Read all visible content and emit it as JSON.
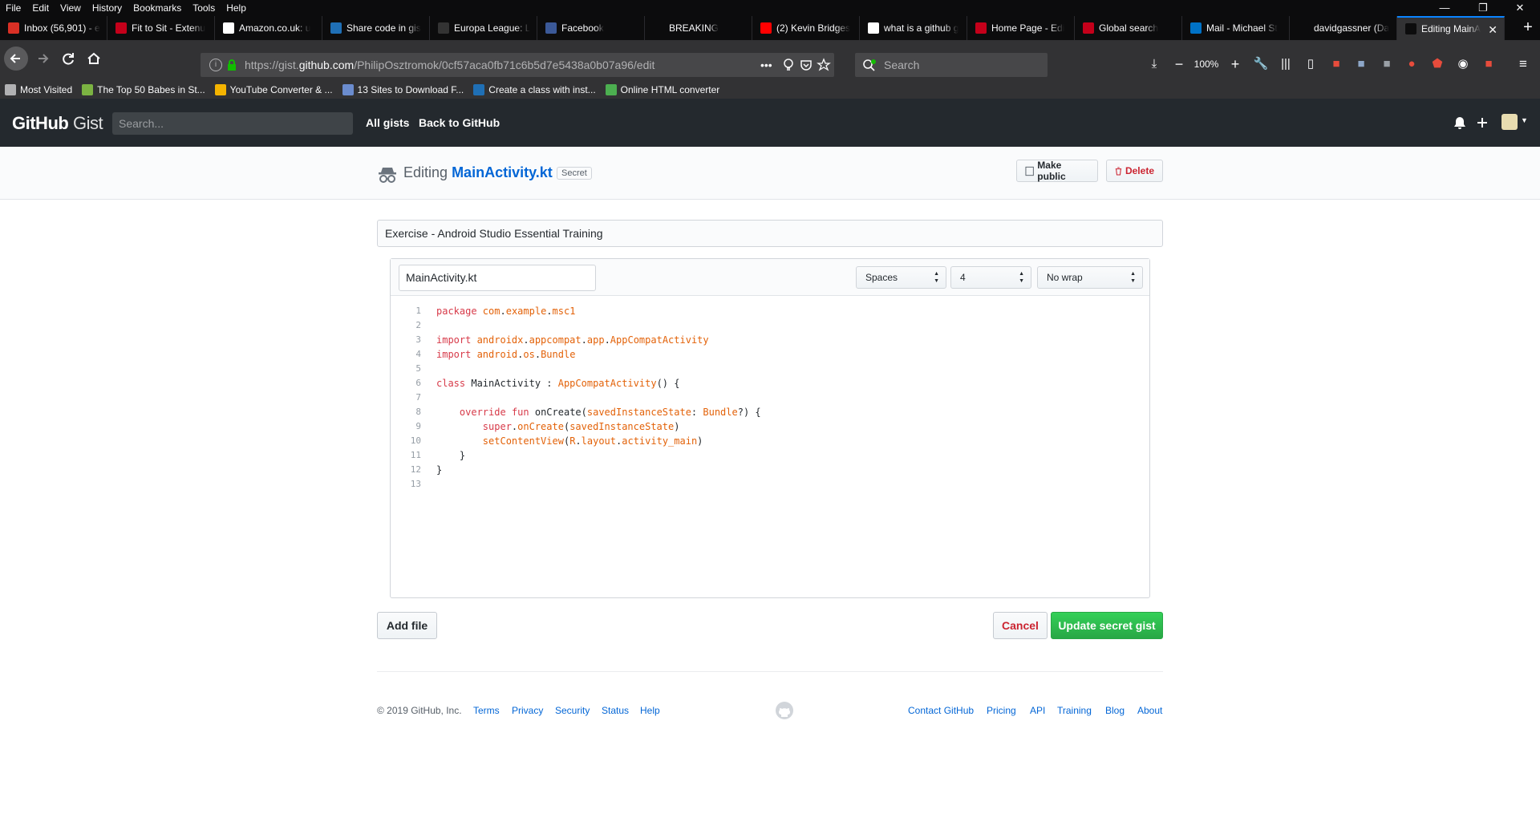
{
  "browser": {
    "menu": [
      "File",
      "Edit",
      "View",
      "History",
      "Bookmarks",
      "Tools",
      "Help"
    ],
    "window_controls": {
      "minimize": "—",
      "restore": "❐",
      "close": "✕"
    },
    "tabs": [
      {
        "label": "Inbox (56,901) - e",
        "icon": "gmail-icon",
        "color": "#d93025"
      },
      {
        "label": "Fit to Sit - Extenu",
        "icon": "bookmark-flag-icon",
        "color": "#c4001a"
      },
      {
        "label": "Amazon.co.uk: u",
        "icon": "amazon-icon",
        "color": "#ffffff"
      },
      {
        "label": "Share code in gis",
        "icon": "play-icon",
        "color": "#1f6fb5"
      },
      {
        "label": "Europa League: L",
        "icon": "bbc-icon",
        "color": "#333333"
      },
      {
        "label": "Facebook",
        "icon": "facebook-icon",
        "color": "#3b5998"
      },
      {
        "label": "BREAKING",
        "icon": "blank-icon",
        "color": "#0c0c0d"
      },
      {
        "label": "(2) Kevin Bridges",
        "icon": "youtube-icon",
        "color": "#ff0000"
      },
      {
        "label": "what is a github g",
        "icon": "google-icon",
        "color": "#ffffff"
      },
      {
        "label": "Home Page - Edi",
        "icon": "bookmark-icon",
        "color": "#c4001a"
      },
      {
        "label": "Global search",
        "icon": "bookmark-flag-icon",
        "color": "#c4001a"
      },
      {
        "label": "Mail - Michael St",
        "icon": "outlook-icon",
        "color": "#0072c6"
      },
      {
        "label": "davidgassner (Da",
        "icon": "github-icon",
        "color": "#0c0c0d"
      },
      {
        "label": "Editing MainA",
        "icon": "github-icon",
        "color": "#0c0c0d",
        "close": "✕"
      }
    ],
    "new_tab": "+",
    "url": {
      "prefix": "https://gist.",
      "host": "github.com",
      "path": "/PhilipOsztromok/0cf57aca0fb71c6b5d7e5438a0b07a96/edit"
    },
    "search_placeholder": "Search",
    "zoom": "100%",
    "page_actions": "•••",
    "bookmarks": [
      {
        "label": "Most Visited",
        "icon": "gear-icon",
        "color": "#b1b1b3"
      },
      {
        "label": "The Top 50 Babes in St...",
        "icon": "bars-icon",
        "color": "#7cb342"
      },
      {
        "label": "YouTube Converter & ...",
        "icon": "converter-icon",
        "color": "#f5b400"
      },
      {
        "label": "13 Sites to Download F...",
        "icon": "page-icon",
        "color": "#6b8cce"
      },
      {
        "label": "Create a class with inst...",
        "icon": "play-icon",
        "color": "#1f6fb5"
      },
      {
        "label": "Online HTML converter",
        "icon": "html-icon",
        "color": "#4caf50"
      }
    ]
  },
  "gist_header": {
    "logo_github": "GitHub",
    "logo_gist": "Gist",
    "search_placeholder": "Search...",
    "nav": [
      "All gists",
      "Back to GitHub"
    ]
  },
  "pagehead": {
    "editing": "Editing",
    "filename": "MainActivity.kt",
    "badge": "Secret",
    "make_public": "Make public",
    "delete": "Delete"
  },
  "form": {
    "description": "Exercise - Android Studio Essential Training",
    "filename_value": "MainActivity.kt",
    "indent_mode": "Spaces",
    "indent_size": "4",
    "wrap_mode": "No wrap"
  },
  "code_lines": [
    [
      [
        "package ",
        "kw"
      ],
      [
        "com",
        "nm"
      ],
      [
        ".",
        "pl"
      ],
      [
        "example",
        "nm"
      ],
      [
        ".",
        "pl"
      ],
      [
        "msc1",
        "nm"
      ]
    ],
    [],
    [
      [
        "import ",
        "kw"
      ],
      [
        "androidx",
        "nm"
      ],
      [
        ".",
        "pl"
      ],
      [
        "appcompat",
        "nm"
      ],
      [
        ".",
        "pl"
      ],
      [
        "app",
        "nm"
      ],
      [
        ".",
        "pl"
      ],
      [
        "AppCompatActivity",
        "nm"
      ]
    ],
    [
      [
        "import ",
        "kw"
      ],
      [
        "android",
        "nm"
      ],
      [
        ".",
        "pl"
      ],
      [
        "os",
        "nm"
      ],
      [
        ".",
        "pl"
      ],
      [
        "Bundle",
        "nm"
      ]
    ],
    [],
    [
      [
        "class ",
        "kw"
      ],
      [
        "MainActivity : ",
        "pl"
      ],
      [
        "AppCompatActivity",
        "nm"
      ],
      [
        "() {",
        "pl"
      ]
    ],
    [],
    [
      [
        "    ",
        "pl"
      ],
      [
        "override ",
        "kw"
      ],
      [
        "fun ",
        "kw"
      ],
      [
        "onCreate(",
        "pl"
      ],
      [
        "savedInstanceState",
        "nm"
      ],
      [
        ": ",
        "pl"
      ],
      [
        "Bundle",
        "nm"
      ],
      [
        "?) {",
        "pl"
      ]
    ],
    [
      [
        "        ",
        "pl"
      ],
      [
        "super",
        "kw"
      ],
      [
        ".",
        "pl"
      ],
      [
        "onCreate",
        "nm"
      ],
      [
        "(",
        "pl"
      ],
      [
        "savedInstanceState",
        "nm"
      ],
      [
        ")",
        "pl"
      ]
    ],
    [
      [
        "        ",
        "pl"
      ],
      [
        "setContentView",
        "nm"
      ],
      [
        "(",
        "pl"
      ],
      [
        "R",
        "nm"
      ],
      [
        ".",
        "pl"
      ],
      [
        "layout",
        "nm"
      ],
      [
        ".",
        "pl"
      ],
      [
        "activity_main",
        "nm"
      ],
      [
        ")",
        "pl"
      ]
    ],
    [
      [
        "    }",
        "pl"
      ]
    ],
    [
      [
        "}",
        "pl"
      ]
    ],
    []
  ],
  "actions": {
    "add_file": "Add file",
    "cancel": "Cancel",
    "update": "Update secret gist"
  },
  "footer": {
    "copyright": "© 2019 GitHub, Inc.",
    "left_links": [
      "Terms",
      "Privacy",
      "Security",
      "Status",
      "Help"
    ],
    "right_links": [
      "Contact GitHub",
      "Pricing",
      "API",
      "Training",
      "Blog",
      "About"
    ]
  },
  "colors": {
    "accent": "#0a84ff",
    "link": "#0366d6",
    "danger": "#cb2431",
    "success": "#28a745"
  }
}
